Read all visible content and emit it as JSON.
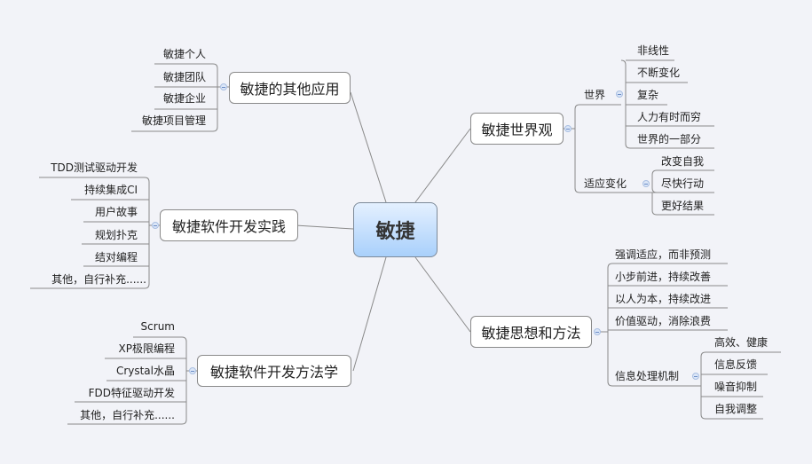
{
  "central": {
    "label": "敏捷"
  },
  "topics": {
    "other_apps": {
      "label": "敏捷的其他应用",
      "children": [
        "敏捷个人",
        "敏捷团队",
        "敏捷企业",
        "敏捷项目管理"
      ]
    },
    "practices": {
      "label": "敏捷软件开发实践",
      "children": [
        "TDD测试驱动开发",
        "持续集成CI",
        "用户故事",
        "规划扑克",
        "结对编程",
        "其他，自行补充......"
      ]
    },
    "methods": {
      "label": "敏捷软件开发方法学",
      "children": [
        "Scrum",
        "XP极限编程",
        "Crystal水晶",
        "FDD特征驱动开发",
        "其他，自行补充......"
      ]
    },
    "worldview": {
      "label": "敏捷世界观",
      "world": {
        "label": "世界",
        "children": [
          "非线性",
          "不断变化",
          "复杂",
          "人力有时而穷",
          "世界的一部分"
        ]
      },
      "adapt": {
        "label": "适应变化",
        "children": [
          "改变自我",
          "尽快行动",
          "更好结果"
        ]
      }
    },
    "thinking": {
      "label": "敏捷思想和方法",
      "children": [
        "强调适应，而非预测",
        "小步前进，持续改善",
        "以人为本，持续改进",
        "价值驱动，消除浪费"
      ],
      "info": {
        "label": "信息处理机制",
        "children": [
          "高效、健康",
          "信息反馈",
          "噪音抑制",
          "自我调整"
        ]
      }
    }
  },
  "colors": {
    "background": "#f2f3f8",
    "line": "#8a8a8a",
    "central_top": "#e4f0ff",
    "central_bottom": "#a9d0fb"
  }
}
